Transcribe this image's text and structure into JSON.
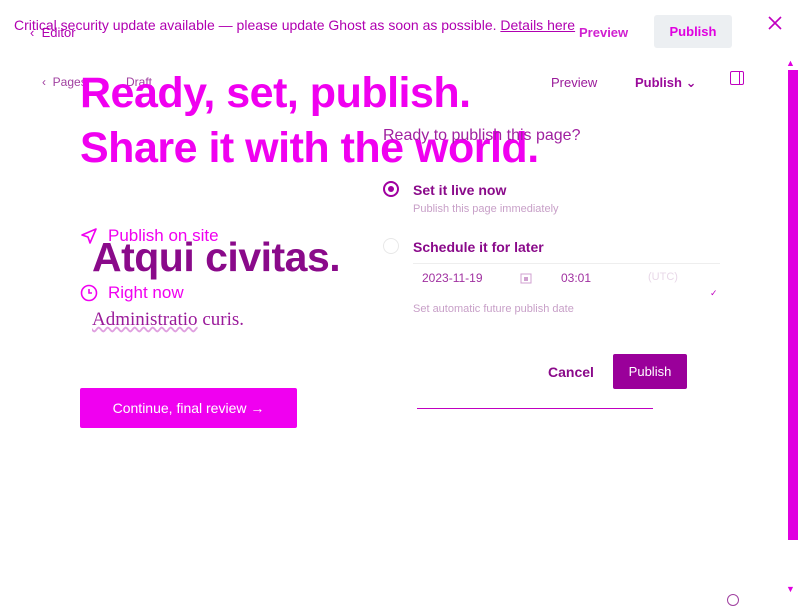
{
  "banner": {
    "message": "Critical security update available — please update Ghost as soon as possible.",
    "link": "Details here"
  },
  "topbar": {
    "back_label": "Editor",
    "preview_label": "Preview",
    "publish_label": "Publish"
  },
  "editor_header": {
    "pages_label": "Pages",
    "status_label": "Draft",
    "preview_label": "Preview",
    "publish_label": "Publish"
  },
  "headline": {
    "line1": "Ready, set, publish.",
    "line2": "Share it with the world."
  },
  "publish_options": {
    "question": "Ready to publish this page?",
    "live_label": "Set it live now",
    "live_desc": "Publish this page immediately",
    "later_label": "Schedule it for later",
    "date": "2023-11-19",
    "time": "03:01",
    "timezone": "(UTC)",
    "future_desc": "Set automatic future publish date"
  },
  "summary": {
    "publish_on_site": "Publish on site",
    "right_now": "Right now"
  },
  "post": {
    "title": "Atqui civitas.",
    "excerpt_word1": "Administratio",
    "excerpt_rest": " curis."
  },
  "buttons": {
    "cancel": "Cancel",
    "publish": "Publish",
    "continue": "Continue, final review →"
  },
  "colors": {
    "accent": "#f000f0",
    "dark_accent": "#8a0a8a"
  }
}
